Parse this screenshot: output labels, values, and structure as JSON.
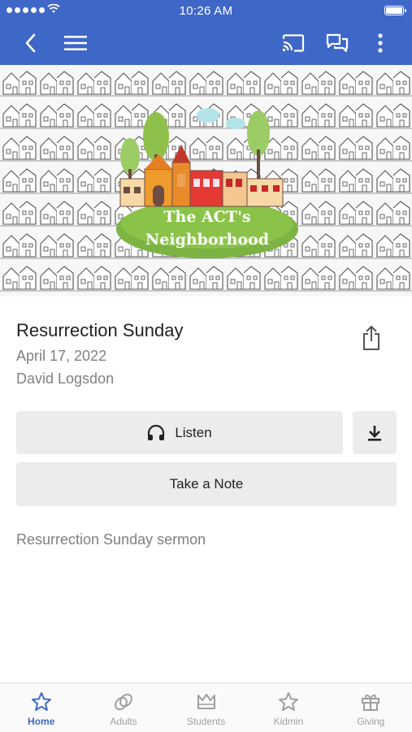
{
  "status_bar": {
    "time": "10:26 AM"
  },
  "nav": {
    "back_icon": "chevron-left-icon",
    "menu_icon": "hamburger-menu-icon",
    "cast_icon": "cast-icon",
    "chat_icon": "chat-bubbles-icon",
    "more_icon": "more-vertical-icon"
  },
  "hero": {
    "line1": "The ACT's",
    "line2": "Neighborhood"
  },
  "sermon": {
    "title": "Resurrection Sunday",
    "date": "April 17, 2022",
    "speaker": "David Logsdon",
    "description": "Resurrection Sunday sermon"
  },
  "actions": {
    "listen_label": "Listen",
    "note_label": "Take a Note"
  },
  "tabs": [
    {
      "label": "Home",
      "icon": "star-icon",
      "active": true
    },
    {
      "label": "Adults",
      "icon": "rings-icon"
    },
    {
      "label": "Students",
      "icon": "crown-icon"
    },
    {
      "label": "Kidmin",
      "icon": "star-icon"
    },
    {
      "label": "Giving",
      "icon": "gift-icon"
    }
  ],
  "colors": {
    "brand": "#3f67c8",
    "button_bg": "#ececee",
    "muted_text": "#808080"
  }
}
